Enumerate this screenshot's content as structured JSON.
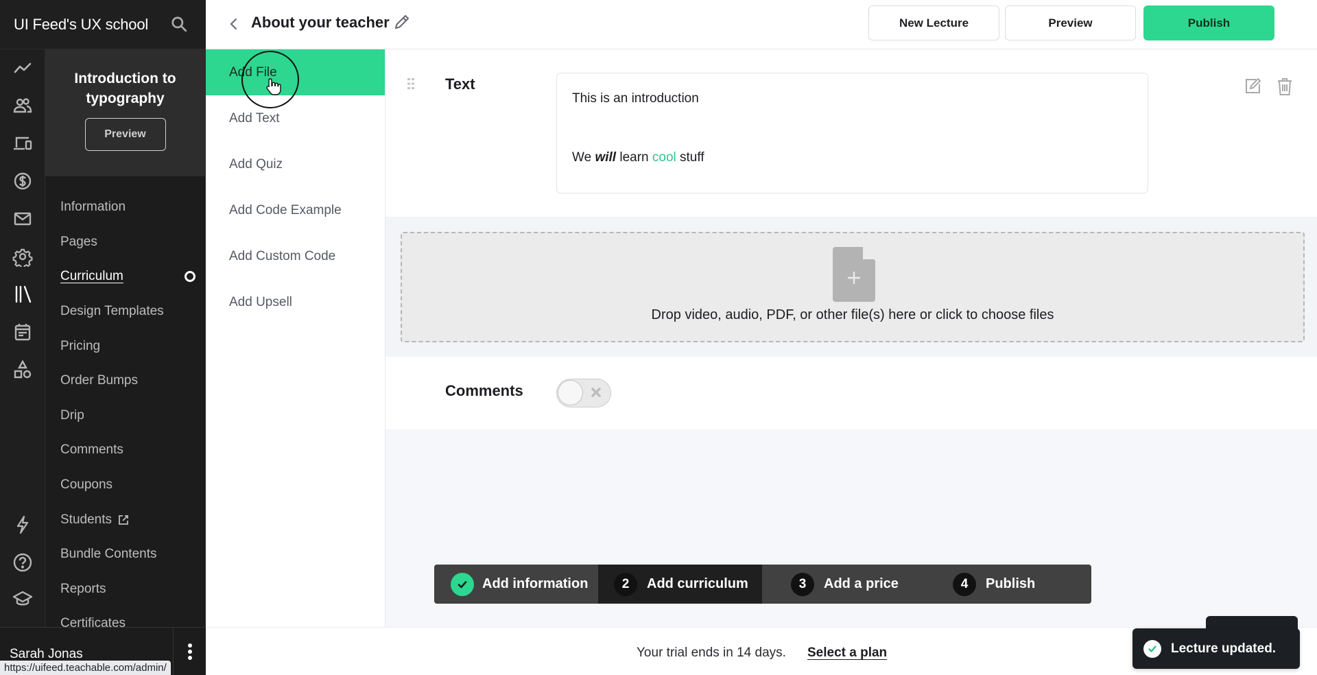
{
  "brand": {
    "title": "UI Feed's UX school"
  },
  "rail": {
    "icons": [
      "analytics-icon",
      "users-icon",
      "devices-icon",
      "dollar-icon",
      "mail-icon",
      "settings-icon",
      "library-icon",
      "calendar-icon",
      "shapes-icon",
      "lightning-icon",
      "help-icon",
      "graduation-cap-icon"
    ]
  },
  "course": {
    "title": "Introduction to typography",
    "preview_label": "Preview",
    "nav": [
      {
        "label": "Information"
      },
      {
        "label": "Pages"
      },
      {
        "label": "Curriculum",
        "active": true
      },
      {
        "label": "Design Templates"
      },
      {
        "label": "Pricing"
      },
      {
        "label": "Order Bumps"
      },
      {
        "label": "Drip"
      },
      {
        "label": "Comments"
      },
      {
        "label": "Coupons"
      },
      {
        "label": "Students",
        "external": true
      },
      {
        "label": "Bundle Contents"
      },
      {
        "label": "Reports"
      },
      {
        "label": "Certificates"
      }
    ]
  },
  "user": {
    "name": "Sarah Jonas"
  },
  "status_bar": {
    "url": "https://uifeed.teachable.com/admin/"
  },
  "header": {
    "title": "About your teacher",
    "buttons": {
      "new_lecture": "New Lecture",
      "preview": "Preview",
      "publish": "Publish"
    }
  },
  "add_panel": {
    "items": [
      "Add File",
      "Add Text",
      "Add Quiz",
      "Add Code Example",
      "Add Custom Code",
      "Add Upsell"
    ],
    "hovered": "Add File"
  },
  "text_block": {
    "label": "Text",
    "line1": "This is an introduction",
    "line2": {
      "before": "We",
      "emphasis": "will",
      "middle": "learn",
      "highlight": "cool",
      "after": "stuff"
    }
  },
  "drop_zone": {
    "text": "Drop video, audio, PDF, or other file(s) here or click to choose files"
  },
  "comments": {
    "label": "Comments",
    "enabled": false
  },
  "stepper": {
    "steps": [
      {
        "number": "",
        "label": "Add information",
        "done": true
      },
      {
        "number": "2",
        "label": "Add curriculum",
        "current": true
      },
      {
        "number": "3",
        "label": "Add a price"
      },
      {
        "number": "4",
        "label": "Publish"
      }
    ]
  },
  "trial": {
    "text": "Your trial ends in 14 days.",
    "link": "Select a plan"
  },
  "toast": {
    "text": "Lecture updated."
  },
  "colors": {
    "accent": "#2dd78f",
    "sidebar_bg": "#1f1f1f",
    "highlight_text": "#2dc58a",
    "toast_bg": "#1c1f23"
  }
}
